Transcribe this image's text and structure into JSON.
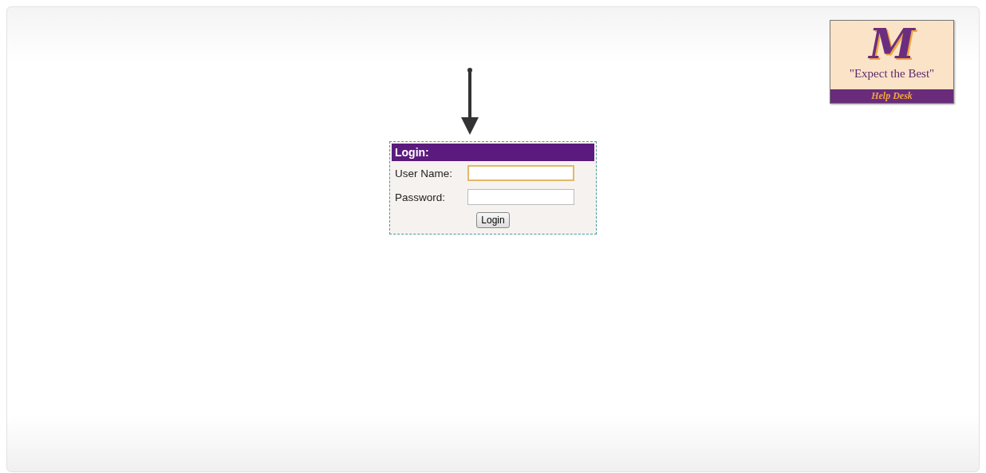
{
  "logo": {
    "monogram": "M",
    "tagline": "\"Expect the Best\"",
    "caption": "Help Desk"
  },
  "login": {
    "title": "Login:",
    "fields": [
      {
        "label": "User Name:",
        "focused": true
      },
      {
        "label": "Password:",
        "focused": false
      }
    ],
    "button": "Login"
  }
}
